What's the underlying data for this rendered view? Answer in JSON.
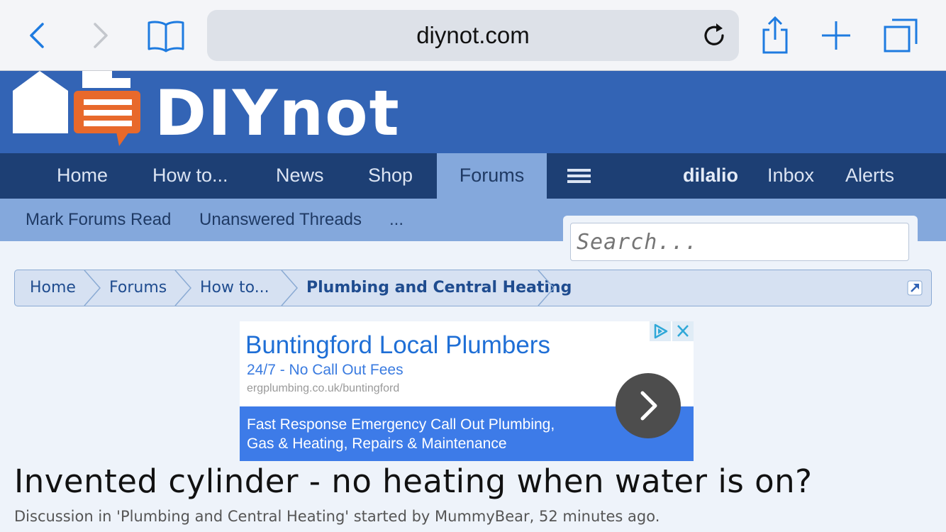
{
  "browser": {
    "url": "diynot.com",
    "accent_color": "#1e7be0",
    "icons": [
      "back-icon",
      "forward-icon",
      "bookmarks-icon",
      "reload-icon",
      "share-icon",
      "new-tab-icon",
      "tabs-icon"
    ]
  },
  "site": {
    "logo_text": "DIYnot",
    "brand_color": "#3364b5",
    "logo_accent": "#e8692b"
  },
  "nav": {
    "items": [
      "Home",
      "How to...",
      "News",
      "Shop",
      "Forums"
    ],
    "active": "Forums",
    "user": "dilalio",
    "inbox": "Inbox",
    "alerts": "Alerts"
  },
  "subnav": {
    "mark_read": "Mark Forums Read",
    "unanswered": "Unanswered Threads",
    "more": "..."
  },
  "search": {
    "placeholder": "Search..."
  },
  "breadcrumb": [
    "Home",
    "Forums",
    "How to...",
    "Plumbing and Central Heating"
  ],
  "ad": {
    "title": "Buntingford Local Plumbers",
    "subtitle": "24/7 - No Call Out Fees",
    "url": "ergplumbing.co.uk/buntingford",
    "body_line1": "Fast Response Emergency Call Out Plumbing,",
    "body_line2": "Gas & Heating, Repairs & Maintenance"
  },
  "thread": {
    "title": "Invented cylinder - no heating when water is on?",
    "meta": "Discussion in 'Plumbing and Central Heating' started by MummyBear, 52 minutes ago."
  }
}
